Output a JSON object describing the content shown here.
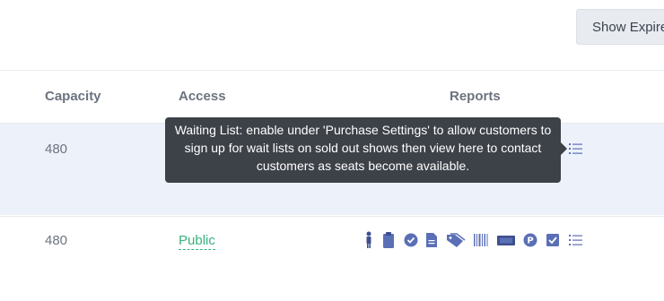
{
  "toolbar": {
    "show_expired_label": "Show Expired"
  },
  "table": {
    "headers": {
      "capacity": "Capacity",
      "access": "Access",
      "reports": "Reports"
    },
    "rows": [
      {
        "capacity": "480",
        "access": ""
      },
      {
        "capacity": "480",
        "access": "Public"
      }
    ]
  },
  "report_icons": [
    "attendee-icon",
    "clipboard-icon",
    "check-circle-icon",
    "document-icon",
    "tag-icon",
    "barcode-icon",
    "ticket-icon",
    "parking-icon",
    "checkbox-icon",
    "waiting-list-icon"
  ],
  "tooltip": {
    "text": "Waiting List: enable under 'Purchase Settings' to allow customers to sign up for wait lists on sold out shows then view here to contact customers as seats become available."
  },
  "colors": {
    "icon": "#5b6fb6",
    "link": "#35b37e",
    "row_highlight": "#edf1fa",
    "tooltip_bg": "#3d4148"
  }
}
